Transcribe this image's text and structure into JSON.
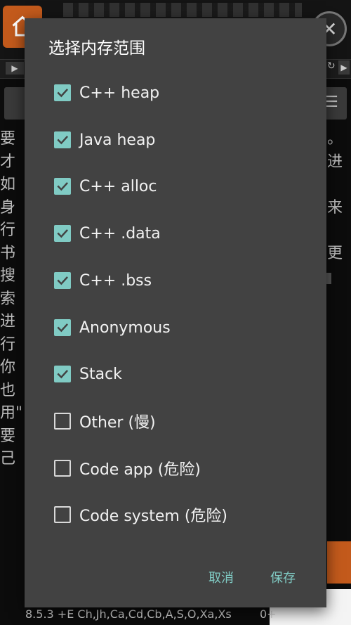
{
  "dialog": {
    "title": "选择内存范围",
    "options": [
      {
        "label": "C++ heap",
        "checked": true
      },
      {
        "label": "Java heap",
        "checked": true
      },
      {
        "label": "C++ alloc",
        "checked": true
      },
      {
        "label": "C++ .data",
        "checked": true
      },
      {
        "label": "C++ .bss",
        "checked": true
      },
      {
        "label": "Anonymous",
        "checked": true
      },
      {
        "label": "Stack",
        "checked": true
      },
      {
        "label": "Other (慢)",
        "checked": false
      },
      {
        "label": "Code app (危险)",
        "checked": false
      },
      {
        "label": "Code system (危险)",
        "checked": false
      }
    ],
    "cancel_label": "取消",
    "save_label": "保存"
  },
  "background": {
    "left_text": [
      "要才",
      "如身",
      "行书",
      "搜索",
      "进行",
      "你也",
      "用\"",
      "要己"
    ],
    "right_text": [
      "。",
      "进",
      "",
      "来",
      "",
      "更",
      ""
    ],
    "status_left": "8.5.3  +E Ch,Jh,Ca,Cd,Cb,A,S,O,Xa,Xs",
    "status_right": "0+"
  },
  "colors": {
    "dialog_bg": "#424242",
    "accent": "#80cbc4",
    "app_accent": "#c35a1c"
  },
  "icons": {
    "home": "home-icon",
    "close": "close-icon",
    "play": "play-icon",
    "refresh": "refresh-icon",
    "menu": "menu-icon",
    "check": "check-icon"
  }
}
